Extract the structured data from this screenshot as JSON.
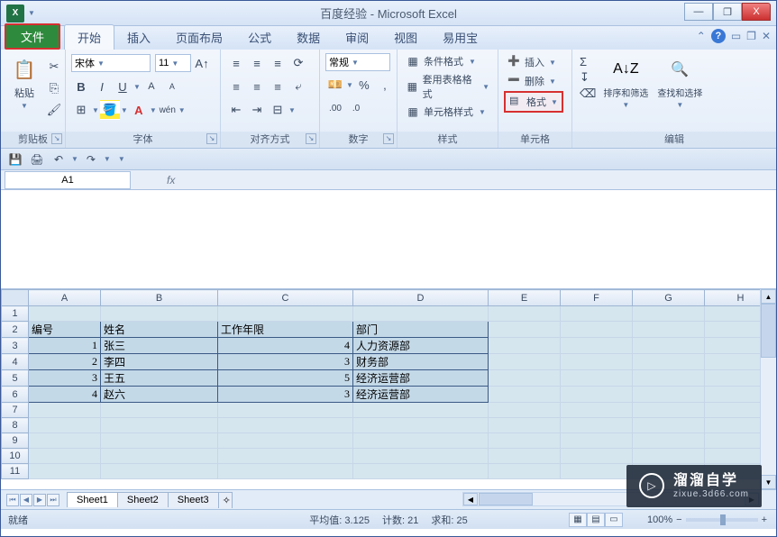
{
  "title": "百度经验 - Microsoft Excel",
  "excel_icon": "X",
  "win": {
    "min": "—",
    "max": "❐",
    "close": "X"
  },
  "tabs": {
    "file": "文件",
    "home": "开始",
    "insert": "插入",
    "layout": "页面布局",
    "formulas": "公式",
    "data": "数据",
    "review": "审阅",
    "view": "视图",
    "yyb": "易用宝"
  },
  "help_controls": {
    "collapse": "⌃",
    "help": "?",
    "wmin": "▭",
    "wmax": "❐",
    "wclose": "✕"
  },
  "ribbon": {
    "clipboard": {
      "paste": "粘贴",
      "label": "剪贴板"
    },
    "font": {
      "name": "宋体",
      "size": "11",
      "bold": "B",
      "italic": "I",
      "underline": "U",
      "label": "字体"
    },
    "align": {
      "label": "对齐方式"
    },
    "number": {
      "style": "常规",
      "label": "数字"
    },
    "styles": {
      "cond": "条件格式",
      "table": "套用表格格式",
      "cell": "单元格样式",
      "label": "样式"
    },
    "cells": {
      "insert": "插入",
      "delete": "删除",
      "format": "格式",
      "label": "单元格"
    },
    "editing": {
      "sum": "Σ",
      "fill": "↧",
      "clear": "⌫",
      "sort": "排序和筛选",
      "find": "查找和选择",
      "label": "编辑"
    }
  },
  "qat2": {
    "save": "💾",
    "undo": "↶",
    "redo": "↷"
  },
  "namebox": "A1",
  "fx": "fx",
  "columns": [
    "A",
    "B",
    "C",
    "D",
    "E",
    "F",
    "G",
    "H"
  ],
  "rows": [
    "1",
    "2",
    "3",
    "4",
    "5",
    "6",
    "7",
    "8",
    "9",
    "10",
    "11"
  ],
  "headers": {
    "id": "编号",
    "name": "姓名",
    "years": "工作年限",
    "dept": "部门"
  },
  "data_rows": [
    {
      "id": "1",
      "name": "张三",
      "years": "4",
      "dept": "人力资源部"
    },
    {
      "id": "2",
      "name": "李四",
      "years": "3",
      "dept": "财务部"
    },
    {
      "id": "3",
      "name": "王五",
      "years": "5",
      "dept": "经济运营部"
    },
    {
      "id": "4",
      "name": "赵六",
      "years": "3",
      "dept": "经济运营部"
    }
  ],
  "sheets": {
    "s1": "Sheet1",
    "s2": "Sheet2",
    "s3": "Sheet3"
  },
  "status": {
    "ready": "就绪",
    "avg_label": "平均值:",
    "avg": "3.125",
    "count_label": "计数:",
    "count": "21",
    "sum_label": "求和:",
    "sum": "25",
    "zoom": "100%",
    "minus": "−",
    "plus": "+"
  },
  "watermark": {
    "main": "溜溜自学",
    "sub": "zixue.3d66.com",
    "play": "▷"
  }
}
